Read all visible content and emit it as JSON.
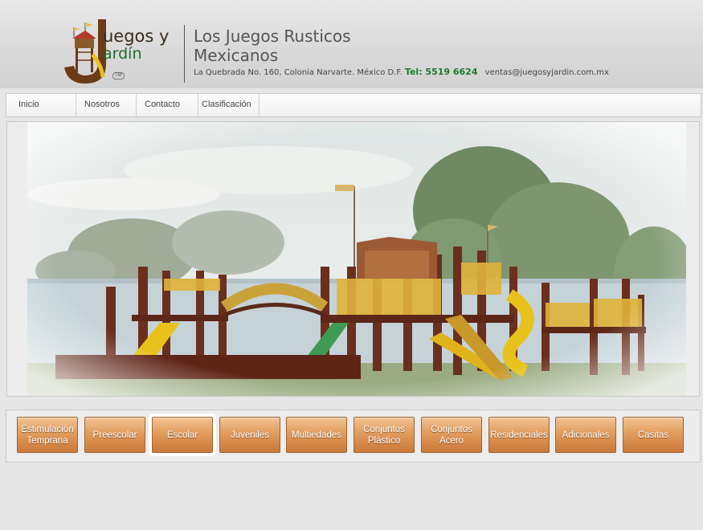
{
  "header": {
    "logo_word1": "uegos y",
    "logo_word2": "ardín",
    "logo_tm": "TM",
    "title": "Los Juegos Rusticos Mexicanos",
    "address": "La Quebrada No. 160, Colonia Narvarte. México D.F.",
    "phone": "Tel: 5519 6624",
    "email": "ventas@juegosyjardin.com.mx"
  },
  "nav": {
    "items": [
      {
        "label": "Inicio"
      },
      {
        "label": "Nosotros"
      },
      {
        "label": "Contacto"
      },
      {
        "label": "Clasificación"
      }
    ]
  },
  "categories": {
    "items": [
      {
        "label": "Estimulación Temprana"
      },
      {
        "label": "Preescolar"
      },
      {
        "label": "Escolar",
        "active": true
      },
      {
        "label": "Juveniles"
      },
      {
        "label": "Multiedades"
      },
      {
        "label": "Conjuntos Plástico"
      },
      {
        "label": "Conjuntos Acero"
      },
      {
        "label": "Residenciales"
      },
      {
        "label": "Adicionales"
      },
      {
        "label": "Casitas"
      }
    ]
  },
  "colors": {
    "accent_green": "#1f7a2e",
    "button_wood": "#d58847"
  }
}
